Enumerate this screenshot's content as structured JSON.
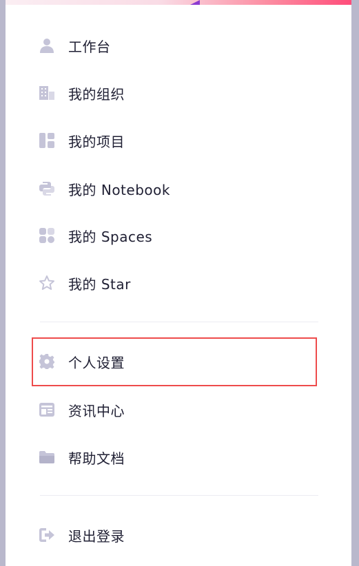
{
  "menu": {
    "items": [
      {
        "label": "工作台",
        "icon": "user-icon"
      },
      {
        "label": "我的组织",
        "icon": "building-icon"
      },
      {
        "label": "我的项目",
        "icon": "layout-icon"
      },
      {
        "label": "我的 Notebook",
        "icon": "python-icon"
      },
      {
        "label": "我的 Spaces",
        "icon": "apps-icon"
      },
      {
        "label": "我的 Star",
        "icon": "star-icon"
      },
      {
        "label": "个人设置",
        "icon": "gear-icon"
      },
      {
        "label": "资讯中心",
        "icon": "news-icon"
      },
      {
        "label": "帮助文档",
        "icon": "folder-icon"
      },
      {
        "label": "退出登录",
        "icon": "logout-icon"
      }
    ]
  },
  "colors": {
    "icon": "#c5c4d8",
    "text": "#1f1f33",
    "highlight_border": "#ee4b4b",
    "divider": "#ececf2"
  }
}
